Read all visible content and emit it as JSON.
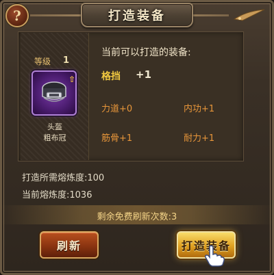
{
  "header": {
    "title": "打造装备",
    "help_glyph": "?",
    "help_icon": "help-icon",
    "deco_icon": "blade-ornament-icon"
  },
  "item": {
    "level_label": "等级",
    "level_value": "1",
    "type": "头盔",
    "name": "粗布冠",
    "icon": "helmet-icon",
    "rarity_color": "#7a3aa8",
    "upgrade_icon": "up-arrow-icon",
    "upgrade_glyph": "⇧"
  },
  "forge": {
    "current_label": "当前可以打造的装备:",
    "main_stat_name": "格挡",
    "main_stat_value": "+1",
    "stats": [
      {
        "label": "力道+0"
      },
      {
        "label": "内功+1"
      },
      {
        "label": "筋骨+1"
      },
      {
        "label": "耐力+1"
      }
    ]
  },
  "resources": {
    "required": "打造所需熔炼度:100",
    "current": "当前熔炼度:1036"
  },
  "refresh_info": "剩余免费刷新次数:3",
  "buttons": {
    "refresh": "刷新",
    "forge": "打造装备",
    "cursor_icon": "pointing-hand-icon"
  }
}
